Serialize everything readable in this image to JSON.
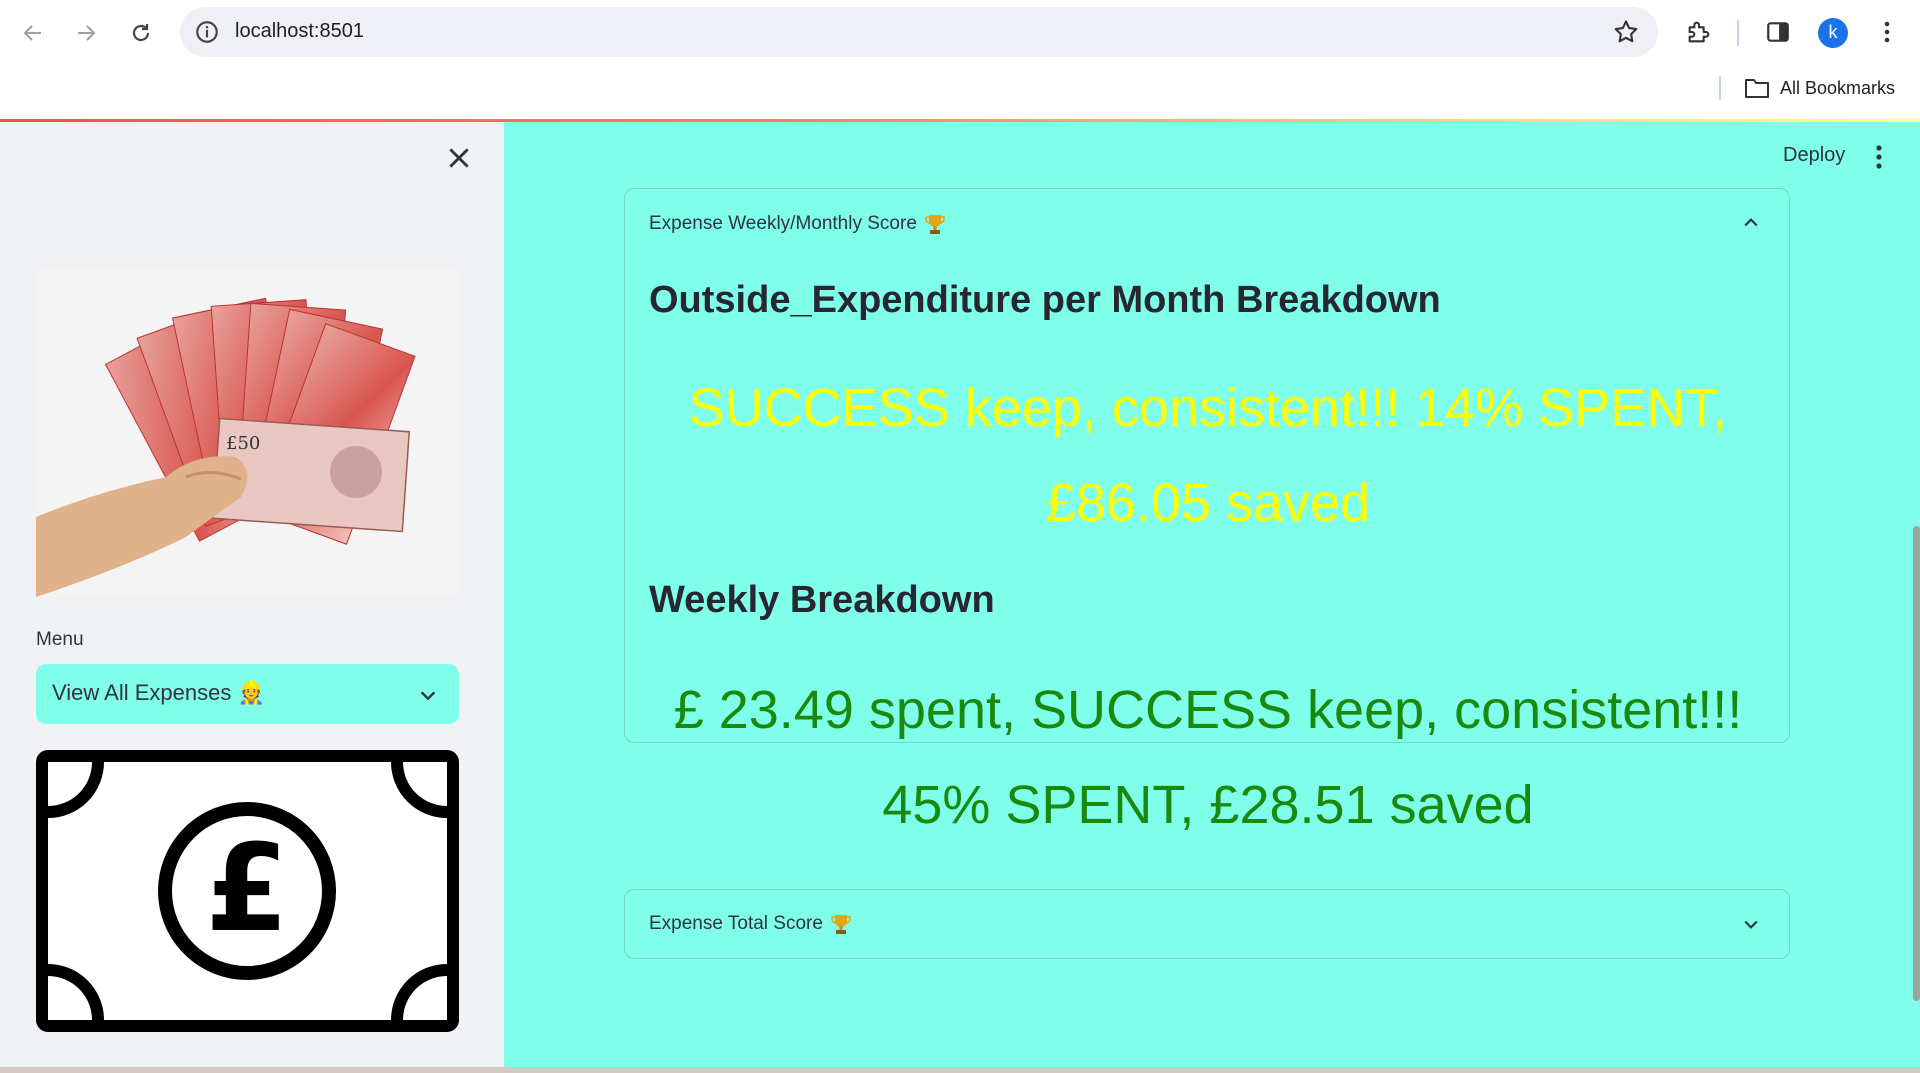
{
  "browser": {
    "url": "localhost:8501",
    "bookmarks_label": "All Bookmarks",
    "profile_initial": "k"
  },
  "sidebar": {
    "menu_label": "Menu",
    "select_value": "View All Expenses 👷"
  },
  "header": {
    "deploy_label": "Deploy"
  },
  "expander_weekly": {
    "title": "Expense Weekly/Monthly Score",
    "expanded": true,
    "monthly_heading": "Outside_Expenditure per Month Breakdown",
    "monthly_message": "SUCCESS keep, consistent!!! 14% SPENT, £86.05 saved",
    "monthly_color": "#ffff00",
    "weekly_heading": "Weekly Breakdown",
    "weekly_message": "£ 23.49 spent, SUCCESS keep, consistent!!! 45% SPENT, £28.51 saved",
    "weekly_color": "#1a8a0f"
  },
  "expander_total": {
    "title": "Expense Total Score",
    "expanded": false
  },
  "colors": {
    "main_background": "#7fffea",
    "sidebar_background": "#f0f2f6",
    "select_background": "#7fffea"
  }
}
